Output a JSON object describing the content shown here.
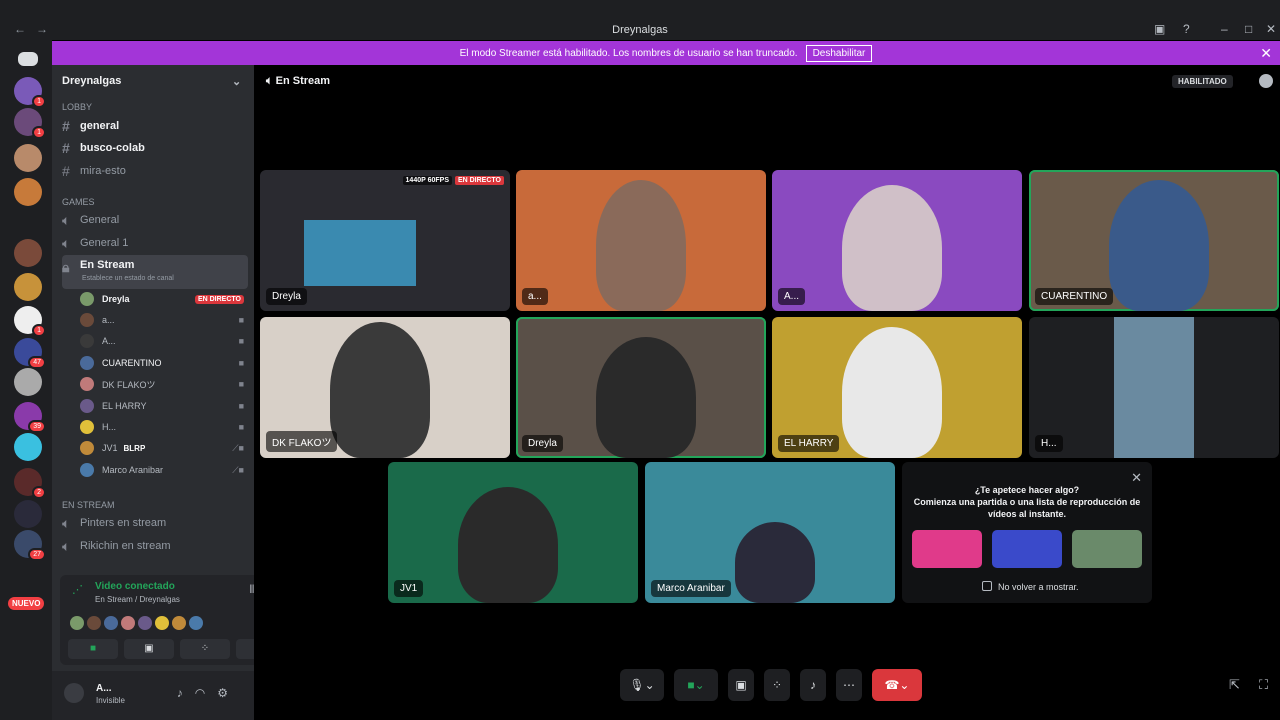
{
  "window": {
    "title": "Dreynalgas"
  },
  "banner": {
    "text": "El modo Streamer está habilitado. Los nombres de usuario se han truncado.",
    "button": "Deshabilitar"
  },
  "server": {
    "name": "Dreynalgas"
  },
  "categories": {
    "lobby": "LOBBY",
    "games": "GAMES",
    "en_stream": "EN STREAM"
  },
  "channels": {
    "general": "general",
    "busco": "busco-colab",
    "mira": "mira-esto",
    "general_voice": "General",
    "general1": "General 1",
    "en_stream": "En Stream",
    "en_stream_sub": "Establece un estado de canal",
    "pinters": "Pinters en stream",
    "rikichin": "Rikichin en stream"
  },
  "voice_users": [
    "Dreyla",
    "a...",
    "A...",
    "CUARENTINO",
    "DK FLAKOツ",
    "EL HARRY",
    "H...",
    "JV1",
    "Marco Aranibar"
  ],
  "live_label": "EN DIRECTO",
  "blrp": "BLRP",
  "server_badges": [
    "1",
    "1",
    "1",
    "47",
    "39",
    "2",
    "27"
  ],
  "nuevo": "NUEVO",
  "voice_panel": {
    "status": "Video conectado",
    "channel": "En Stream / Dreynalgas"
  },
  "user": {
    "name": "A...",
    "status": "Invisible"
  },
  "main": {
    "channel": "En Stream",
    "habilitado": "HABILITADO"
  },
  "tiles": [
    {
      "name": "Dreyla",
      "live": "EN DIRECTO",
      "quality": "1440P 60FPS"
    },
    {
      "name": "a..."
    },
    {
      "name": "A..."
    },
    {
      "name": "CUARENTINO"
    },
    {
      "name": "DK FLAKOツ"
    },
    {
      "name": "Dreyla"
    },
    {
      "name": "EL HARRY"
    },
    {
      "name": "H..."
    },
    {
      "name": "JV1"
    },
    {
      "name": "Marco Aranibar"
    }
  ],
  "activity": {
    "question": "¿Te apetece hacer algo?",
    "desc": "Comienza una partida o una lista de reproducción de vídeos al instante.",
    "dont_show": "No volver a mostrar."
  },
  "colors": {
    "accent": "#a335d8",
    "live": "#da373c",
    "speaking": "#23a55a"
  }
}
